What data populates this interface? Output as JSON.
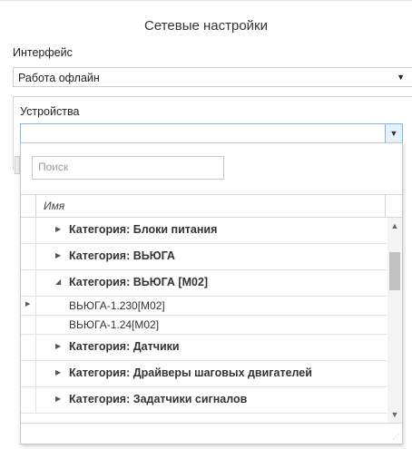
{
  "dialog": {
    "title": "Сетевые настройки"
  },
  "interface": {
    "label": "Интерфейс",
    "value": "Работа офлайн"
  },
  "devices": {
    "group_label": "Устройства",
    "search_placeholder": "Поиск",
    "column_header": "Имя",
    "rows": [
      {
        "label": "Категория: Блоки питания"
      },
      {
        "label": "Категория: ВЬЮГА"
      },
      {
        "label": "Категория: ВЬЮГА [M02]"
      },
      {
        "label": "ВЬЮГА-1.230[M02]"
      },
      {
        "label": "ВЬЮГА-1.24[M02]"
      },
      {
        "label": "Категория: Датчики"
      },
      {
        "label": "Категория: Драйверы шаговых двигателей"
      },
      {
        "label": "Категория: Задатчики сигналов"
      }
    ]
  },
  "icons": {
    "expand": "triangle-right-icon",
    "collapse": "triangle-down-icon",
    "dropdown": "chevron-down-icon",
    "resize": "resize-grip-icon"
  }
}
